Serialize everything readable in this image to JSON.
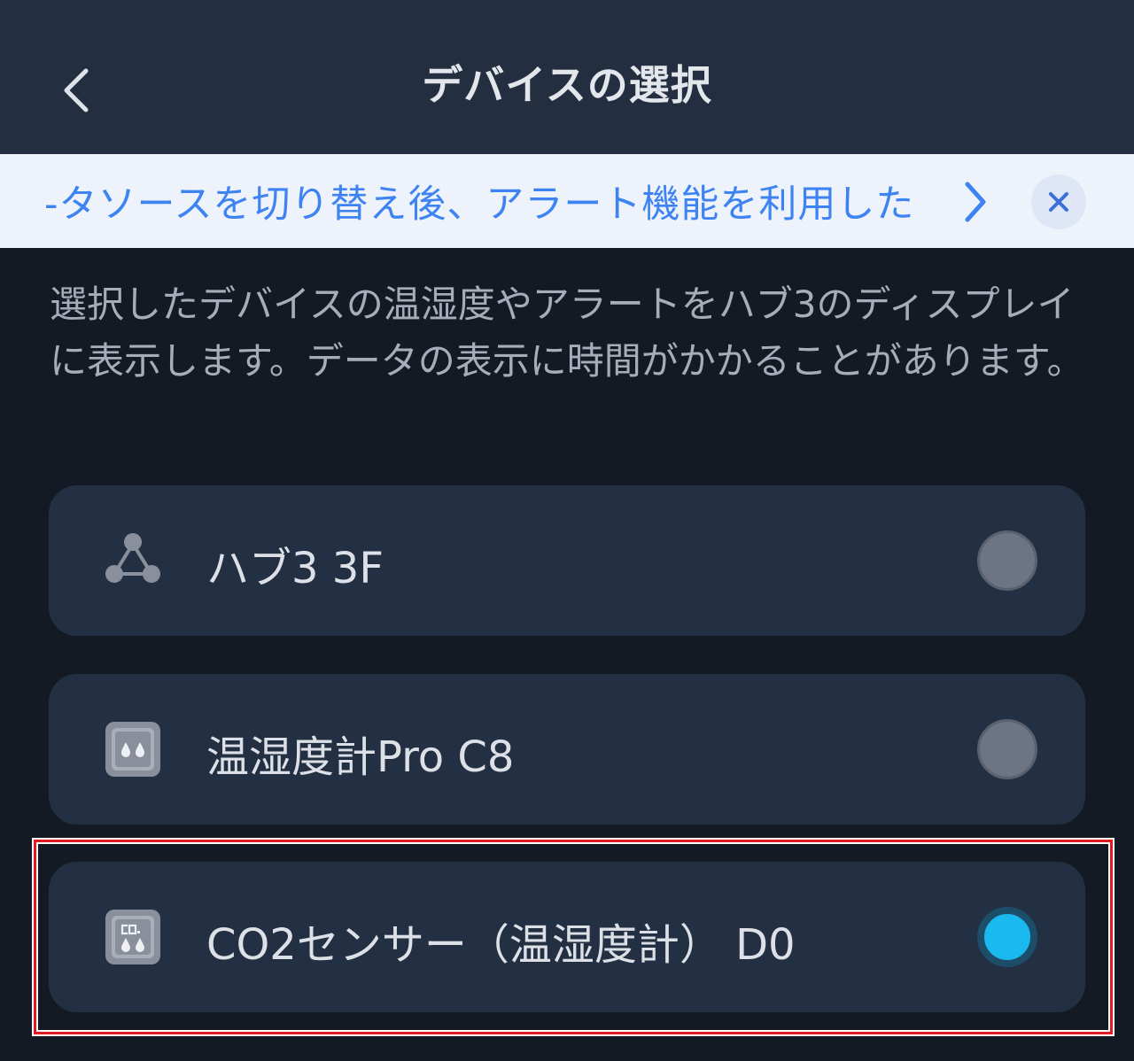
{
  "header": {
    "title": "デバイスの選択",
    "back_icon": "chevron-left-icon"
  },
  "notice": {
    "text": "-タソースを切り替え後、アラート機能を利用した",
    "chevron_icon": "chevron-right-icon",
    "close_icon": "close-icon"
  },
  "description": "選択したデバイスの温湿度やアラートをハブ3のディスプレイに表示します。データの表示に時間がかかることがあります。",
  "devices": [
    {
      "name": "ハブ3 3F",
      "icon": "hub-icon",
      "selected": false
    },
    {
      "name": "温湿度計Pro C8",
      "icon": "thermo-hygrometer-icon",
      "selected": false
    },
    {
      "name": "CO2センサー（温湿度計） D0",
      "icon": "co2-sensor-icon",
      "selected": true
    }
  ],
  "colors": {
    "accent": "#1abaf0",
    "notice_text": "#3e83f2",
    "highlight": "#e01b24"
  }
}
